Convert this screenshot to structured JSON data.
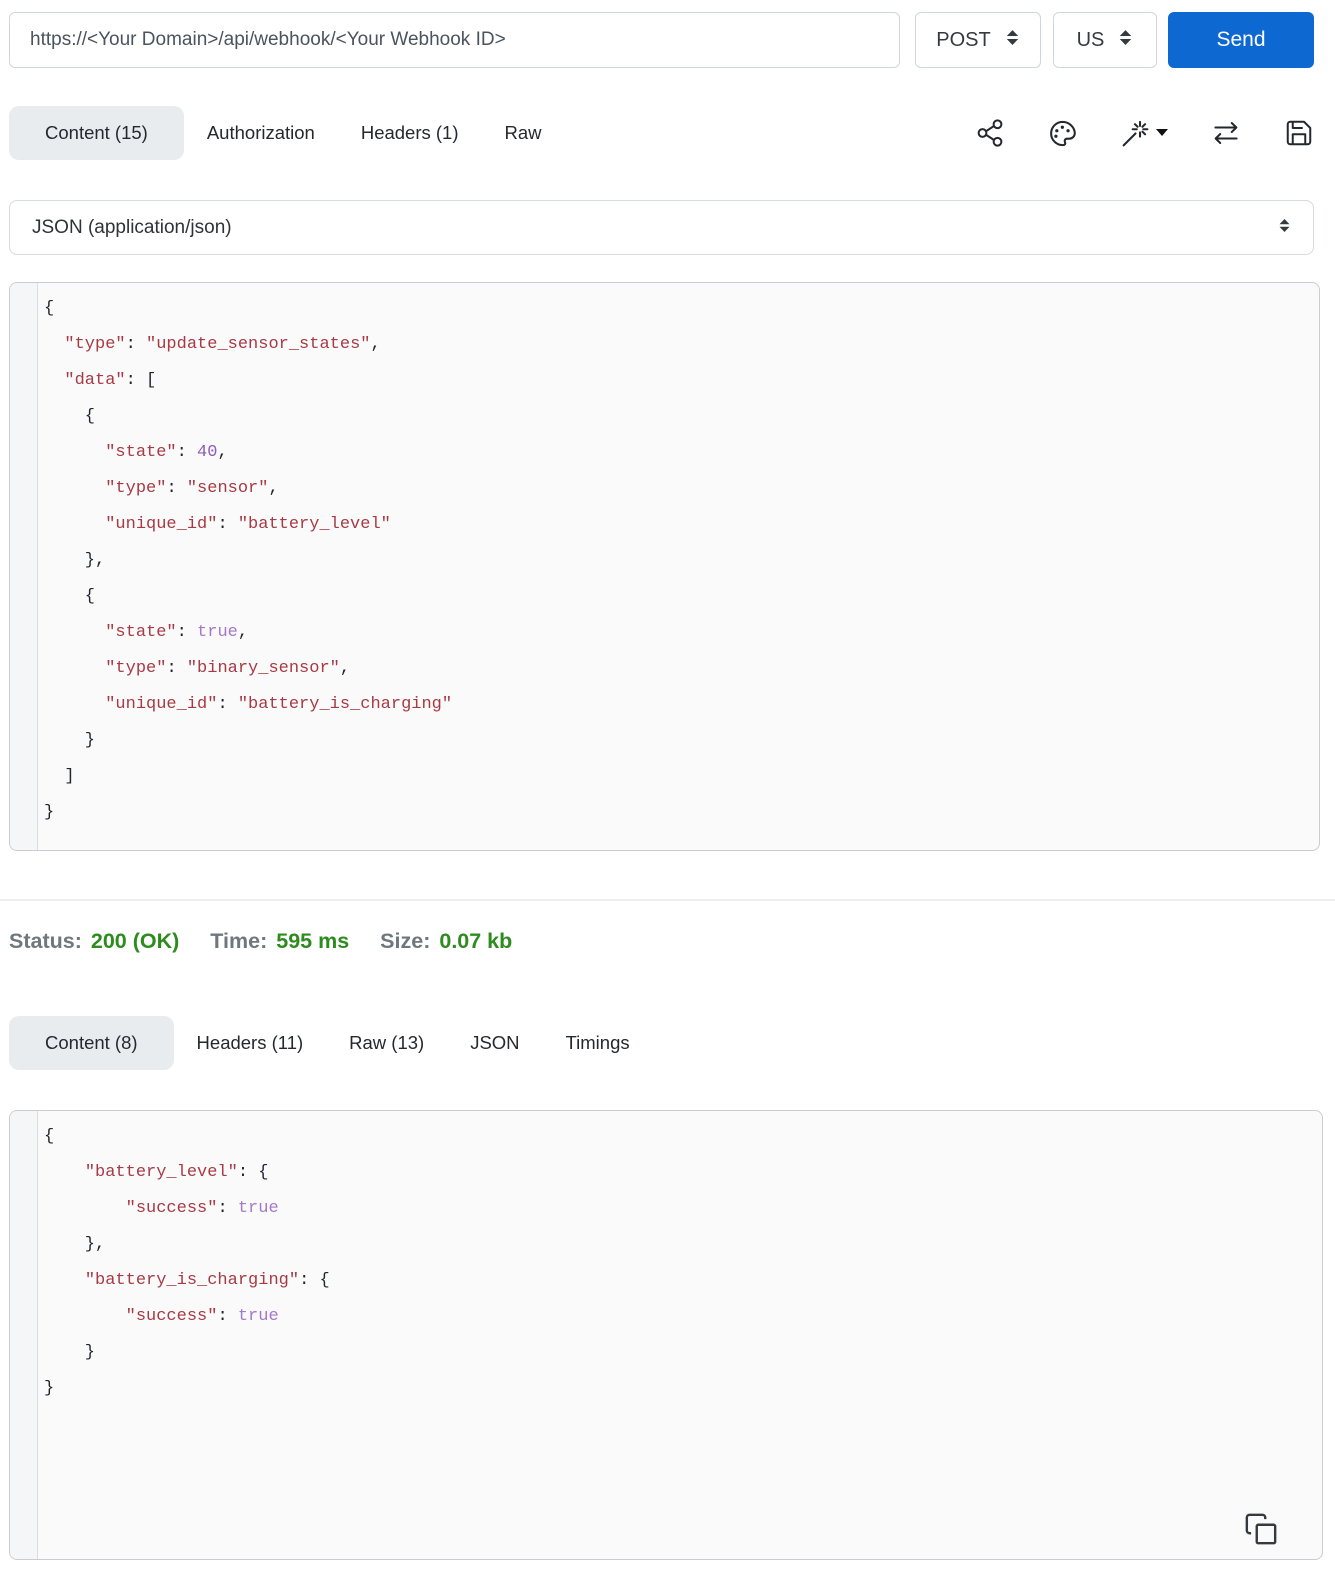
{
  "request_bar": {
    "url": "https://<Your Domain>/api/webhook/<Your Webhook ID>",
    "method": "POST",
    "locale": "US",
    "send_label": "Send"
  },
  "request_tabs": {
    "content": "Content (15)",
    "authorization": "Authorization",
    "headers": "Headers (1)",
    "raw": "Raw"
  },
  "toolbar": {
    "icons": [
      "share-icon",
      "palette-icon",
      "magic-wand-icon",
      "swap-arrows-icon",
      "save-icon"
    ]
  },
  "body_type_select": {
    "value": "JSON (application/json)"
  },
  "request_code": {
    "lines": [
      [
        [
          "p",
          "{"
        ]
      ],
      [
        [
          "p",
          "  "
        ],
        [
          "k",
          "\"type\""
        ],
        [
          "p",
          ": "
        ],
        [
          "k",
          "\"update_sensor_states\""
        ],
        [
          "p",
          ","
        ]
      ],
      [
        [
          "p",
          "  "
        ],
        [
          "k",
          "\"data\""
        ],
        [
          "p",
          ": ["
        ]
      ],
      [
        [
          "p",
          "    {"
        ]
      ],
      [
        [
          "p",
          "      "
        ],
        [
          "k",
          "\"state\""
        ],
        [
          "p",
          ": "
        ],
        [
          "n",
          "40"
        ],
        [
          "p",
          ","
        ]
      ],
      [
        [
          "p",
          "      "
        ],
        [
          "k",
          "\"type\""
        ],
        [
          "p",
          ": "
        ],
        [
          "k",
          "\"sensor\""
        ],
        [
          "p",
          ","
        ]
      ],
      [
        [
          "p",
          "      "
        ],
        [
          "k",
          "\"unique_id\""
        ],
        [
          "p",
          ": "
        ],
        [
          "k",
          "\"battery_level\""
        ]
      ],
      [
        [
          "p",
          "    },"
        ]
      ],
      [
        [
          "p",
          "    {"
        ]
      ],
      [
        [
          "p",
          "      "
        ],
        [
          "k",
          "\"state\""
        ],
        [
          "p",
          ": "
        ],
        [
          "b",
          "true"
        ],
        [
          "p",
          ","
        ]
      ],
      [
        [
          "p",
          "      "
        ],
        [
          "k",
          "\"type\""
        ],
        [
          "p",
          ": "
        ],
        [
          "k",
          "\"binary_sensor\""
        ],
        [
          "p",
          ","
        ]
      ],
      [
        [
          "p",
          "      "
        ],
        [
          "k",
          "\"unique_id\""
        ],
        [
          "p",
          ": "
        ],
        [
          "k",
          "\"battery_is_charging\""
        ]
      ],
      [
        [
          "p",
          "    }"
        ]
      ],
      [
        [
          "p",
          "  ]"
        ]
      ],
      [
        [
          "p",
          "}"
        ]
      ]
    ]
  },
  "status_bar": {
    "status_label": "Status:",
    "status_value": "200 (OK)",
    "time_label": "Time:",
    "time_value": "595 ms",
    "size_label": "Size:",
    "size_value": "0.07 kb"
  },
  "response_tabs": {
    "content": "Content (8)",
    "headers": "Headers (11)",
    "raw": "Raw (13)",
    "json": "JSON",
    "timings": "Timings"
  },
  "response_code": {
    "lines": [
      [
        [
          "p",
          "{"
        ]
      ],
      [
        [
          "p",
          "    "
        ],
        [
          "k",
          "\"battery_level\""
        ],
        [
          "p",
          ": {"
        ]
      ],
      [
        [
          "p",
          "        "
        ],
        [
          "k",
          "\"success\""
        ],
        [
          "p",
          ": "
        ],
        [
          "b",
          "true"
        ]
      ],
      [
        [
          "p",
          "    },"
        ]
      ],
      [
        [
          "p",
          "    "
        ],
        [
          "k",
          "\"battery_is_charging\""
        ],
        [
          "p",
          ": {"
        ]
      ],
      [
        [
          "p",
          "        "
        ],
        [
          "k",
          "\"success\""
        ],
        [
          "p",
          ": "
        ],
        [
          "b",
          "true"
        ]
      ],
      [
        [
          "p",
          "    }"
        ]
      ],
      [
        [
          "p",
          "}"
        ]
      ]
    ]
  },
  "colors": {
    "send_button_blue": "#0d68d2",
    "success_green": "#2e8b1e",
    "active_tab_bg": "#e9ecef",
    "code_string": "#a73a44",
    "code_number": "#8d5cb8",
    "code_boolean": "#a678cb",
    "code_punctuation": "#21262d"
  }
}
